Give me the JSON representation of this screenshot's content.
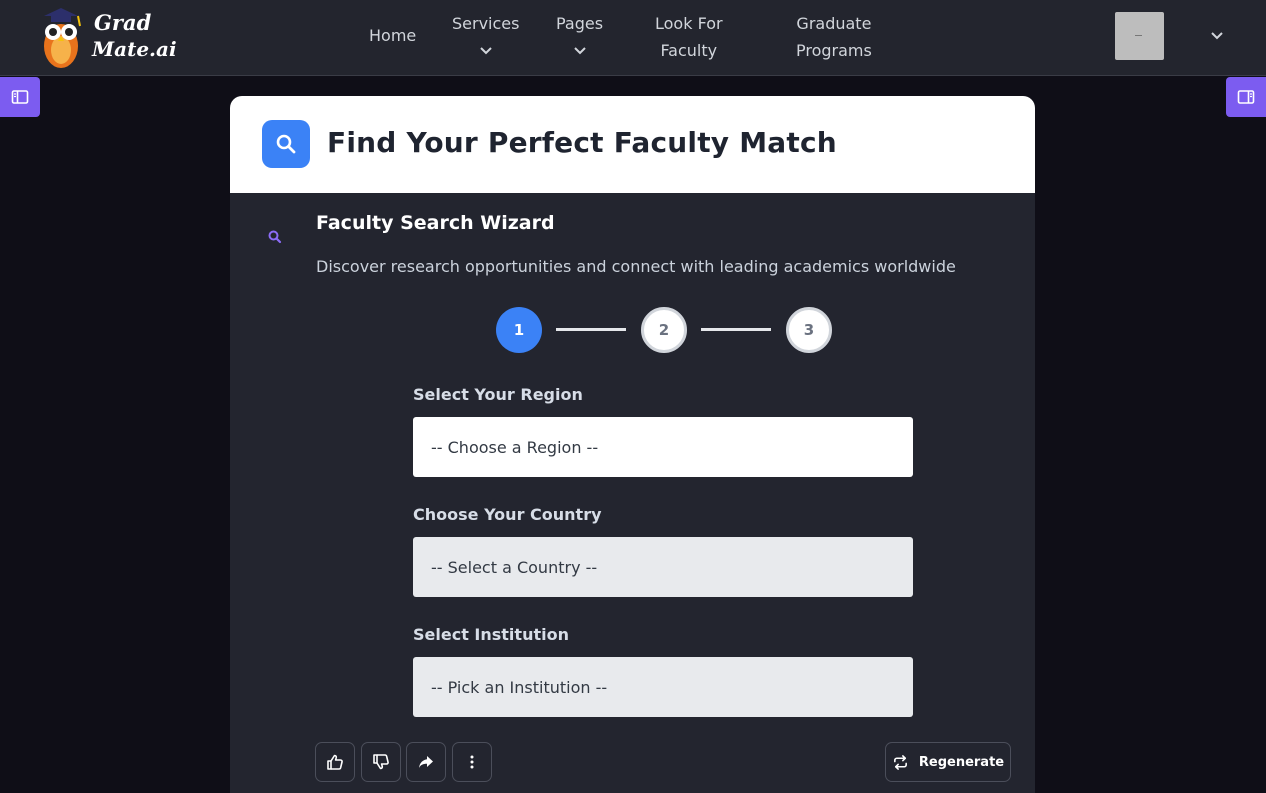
{
  "brand": {
    "line1": "Grad",
    "line2": "Mate.ai"
  },
  "nav": {
    "home": "Home",
    "services": "Services",
    "pages": "Pages",
    "faculty_line1": "Look For",
    "faculty_line2": "Faculty",
    "graduate_line1": "Graduate",
    "graduate_line2": "Programs"
  },
  "header": {
    "title": "Find Your Perfect Faculty Match"
  },
  "wizard": {
    "title": "Faculty Search Wizard",
    "subtitle": "Discover research opportunities and connect with leading academics worldwide",
    "steps": [
      "1",
      "2",
      "3"
    ],
    "current_step": 1
  },
  "fields": {
    "region": {
      "label": "Select Your Region",
      "value": "-- Choose a Region --"
    },
    "country": {
      "label": "Choose Your Country",
      "value": "-- Select a Country --"
    },
    "institution": {
      "label": "Select Institution",
      "value": "-- Pick an Institution --"
    }
  },
  "actions": {
    "regenerate": "Regenerate"
  },
  "colors": {
    "accent_blue": "#3b82f6",
    "sidebar_purple": "#7c5cf0",
    "topbar": "#23252e",
    "background": "#0f0e17"
  },
  "icons": {
    "search": "search-icon",
    "thumbs_up": "thumbs-up-icon",
    "thumbs_down": "thumbs-down-icon",
    "share": "share-icon",
    "more": "more-vertical-icon",
    "regenerate": "refresh-icon"
  }
}
